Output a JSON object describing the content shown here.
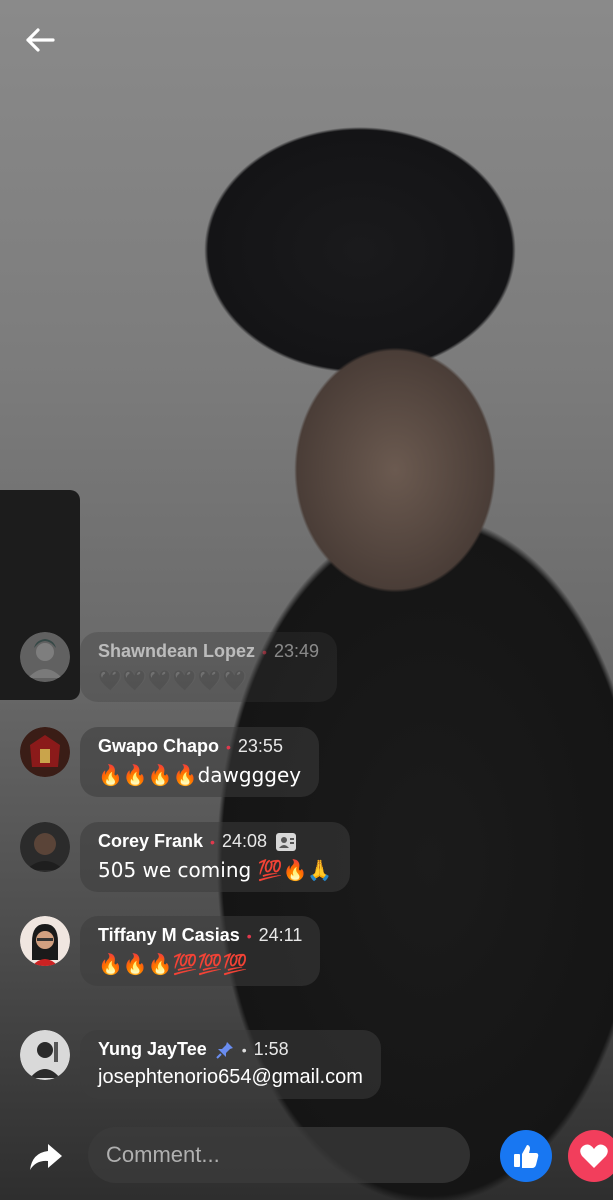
{
  "header": {
    "back_icon": "arrow-left-icon"
  },
  "comments": [
    {
      "name": "Shawndean Lopez",
      "time": "23:49",
      "text": "🖤🖤🖤🖤🖤🖤",
      "dot": "red"
    },
    {
      "name": "Gwapo Chapo",
      "time": "23:55",
      "text": "🔥🔥🔥🔥dawgggey",
      "dot": "red"
    },
    {
      "name": "Corey Frank",
      "time": "24:08",
      "text": "505 we coming 💯🔥🙏",
      "dot": "red",
      "badge_icon": "profile-card-icon"
    },
    {
      "name": "Tiffany M Casias",
      "time": "24:11",
      "text": "🔥🔥🔥💯💯💯",
      "dot": "red"
    },
    {
      "name": "Yung JayTee",
      "time": "1:58",
      "text": "josephtenorio654@gmail.com",
      "dot": "white",
      "pinned_icon": "pin-icon"
    }
  ],
  "footer": {
    "comment_placeholder": "Comment...",
    "share_icon": "share-arrow-icon",
    "like_icon": "thumbs-up-icon",
    "love_icon": "heart-icon"
  },
  "colors": {
    "like": "#1877f2",
    "love": "#f23e5c",
    "dot": "#e0394d"
  }
}
